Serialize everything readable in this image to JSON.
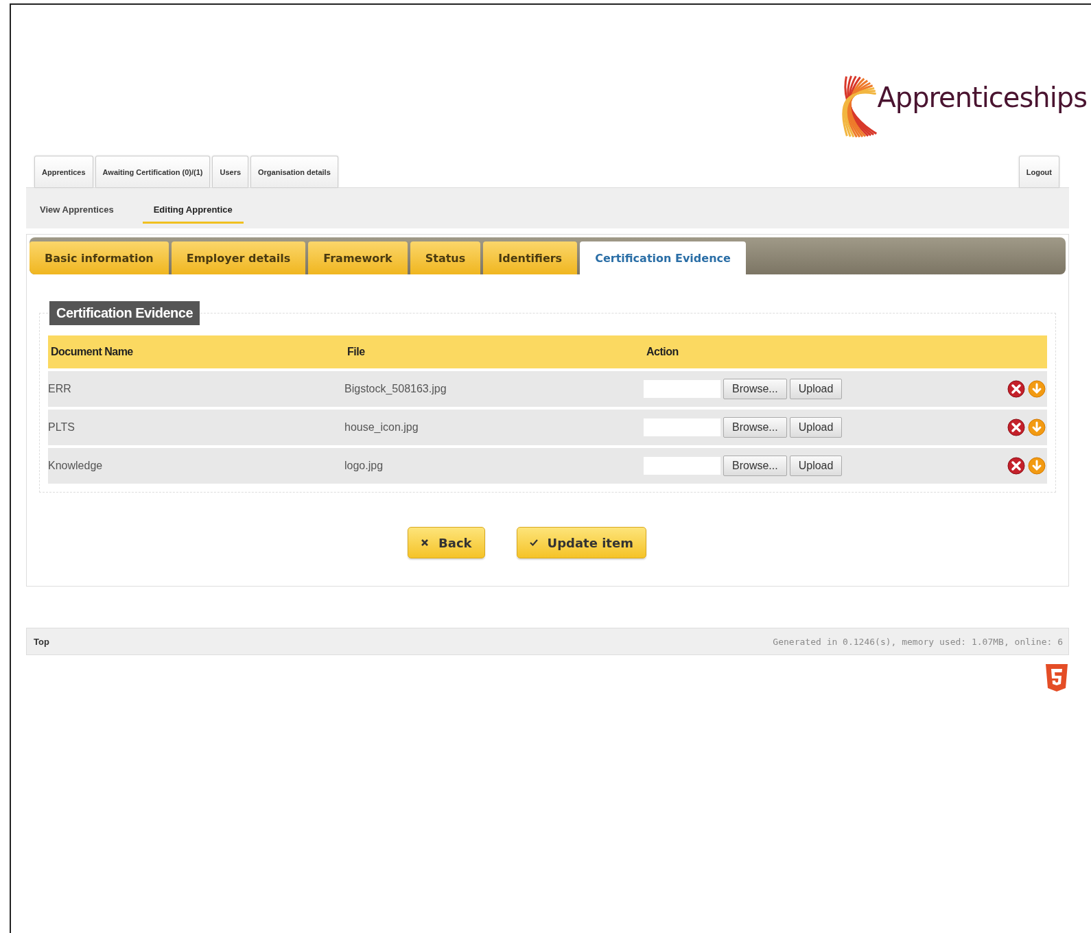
{
  "logo": {
    "text": "Apprenticeships"
  },
  "main_tabs": [
    {
      "label": "Apprentices",
      "selected": false
    },
    {
      "label": "Awaiting Certification (0)/(1)",
      "selected": false
    },
    {
      "label": "Users",
      "selected": false
    },
    {
      "label": "Organisation details",
      "selected": false
    }
  ],
  "logout": "Logout",
  "sub_nav": [
    {
      "label": "View Apprentices",
      "selected": false
    },
    {
      "label": "Editing Apprentice",
      "selected": true
    }
  ],
  "section_tabs": [
    {
      "label": "Basic information",
      "selected": false
    },
    {
      "label": "Employer details",
      "selected": false
    },
    {
      "label": "Framework",
      "selected": false
    },
    {
      "label": "Status",
      "selected": false
    },
    {
      "label": "Identifiers",
      "selected": false
    },
    {
      "label": "Certification Evidence",
      "selected": true
    }
  ],
  "fieldset": {
    "legend": "Certification Evidence",
    "columns": [
      "Document Name",
      "File",
      "Action"
    ],
    "rows": [
      {
        "name": "ERR",
        "file": "Bigstock_508163.jpg",
        "browse": "Browse...",
        "upload": "Upload"
      },
      {
        "name": "PLTS",
        "file": "house_icon.jpg",
        "browse": "Browse...",
        "upload": "Upload"
      },
      {
        "name": "Knowledge",
        "file": "logo.jpg",
        "browse": "Browse...",
        "upload": "Upload"
      }
    ]
  },
  "buttons": [
    {
      "kind": "cancel",
      "label": "Back"
    },
    {
      "kind": "confirm",
      "label": "Update item"
    }
  ],
  "footer": {
    "top_link": "Top",
    "stats": "Generated in 0.1246(s), memory used: 1.07MB, online: 6"
  }
}
